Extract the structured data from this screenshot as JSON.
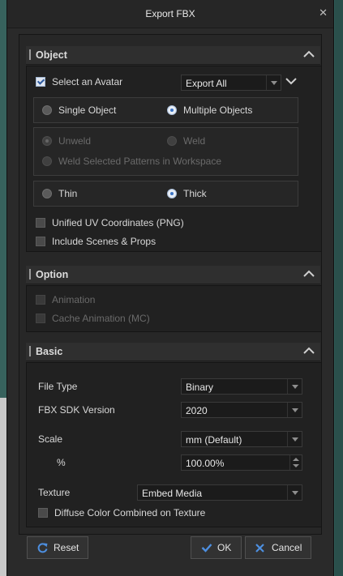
{
  "window": {
    "title": "Export FBX",
    "close_glyph": "✕"
  },
  "object": {
    "header": "Object",
    "select_avatar": {
      "label": "Select an Avatar",
      "checked": true
    },
    "export_dropdown": {
      "value": "Export All"
    },
    "mode_single": {
      "label": "Single Object",
      "selected": false
    },
    "mode_multiple": {
      "label": "Multiple Objects",
      "selected": true
    },
    "unweld": {
      "label": "Unweld",
      "selected": true,
      "disabled": true
    },
    "weld": {
      "label": "Weld",
      "selected": false,
      "disabled": true
    },
    "weld_selected": {
      "label": "Weld Selected Patterns in Workspace",
      "selected": false,
      "disabled": true
    },
    "thin": {
      "label": "Thin",
      "selected": false
    },
    "thick": {
      "label": "Thick",
      "selected": true
    },
    "unified_uv": {
      "label": "Unified UV Coordinates (PNG)",
      "checked": false
    },
    "include_scenes": {
      "label": "Include Scenes & Props",
      "checked": false
    }
  },
  "option": {
    "header": "Option",
    "animation": {
      "label": "Animation",
      "checked": false,
      "disabled": true
    },
    "cache_animation": {
      "label": "Cache Animation (MC)",
      "checked": false,
      "disabled": true
    }
  },
  "basic": {
    "header": "Basic",
    "file_type": {
      "label": "File Type",
      "value": "Binary"
    },
    "sdk_version": {
      "label": "FBX SDK Version",
      "value": "2020"
    },
    "scale": {
      "label": "Scale",
      "value": "mm (Default)"
    },
    "percent": {
      "label": "%",
      "value": "100.00%"
    },
    "texture": {
      "label": "Texture",
      "value": "Embed Media"
    },
    "diffuse": {
      "label": "Diffuse Color Combined on Texture",
      "checked": false
    }
  },
  "buttons": {
    "reset": "Reset",
    "ok": "OK",
    "cancel": "Cancel"
  },
  "colors": {
    "accent": "#3b74c4",
    "dialog_bg": "#2a2a2a",
    "panel_bg": "#212121",
    "background": "#2f5a56"
  }
}
